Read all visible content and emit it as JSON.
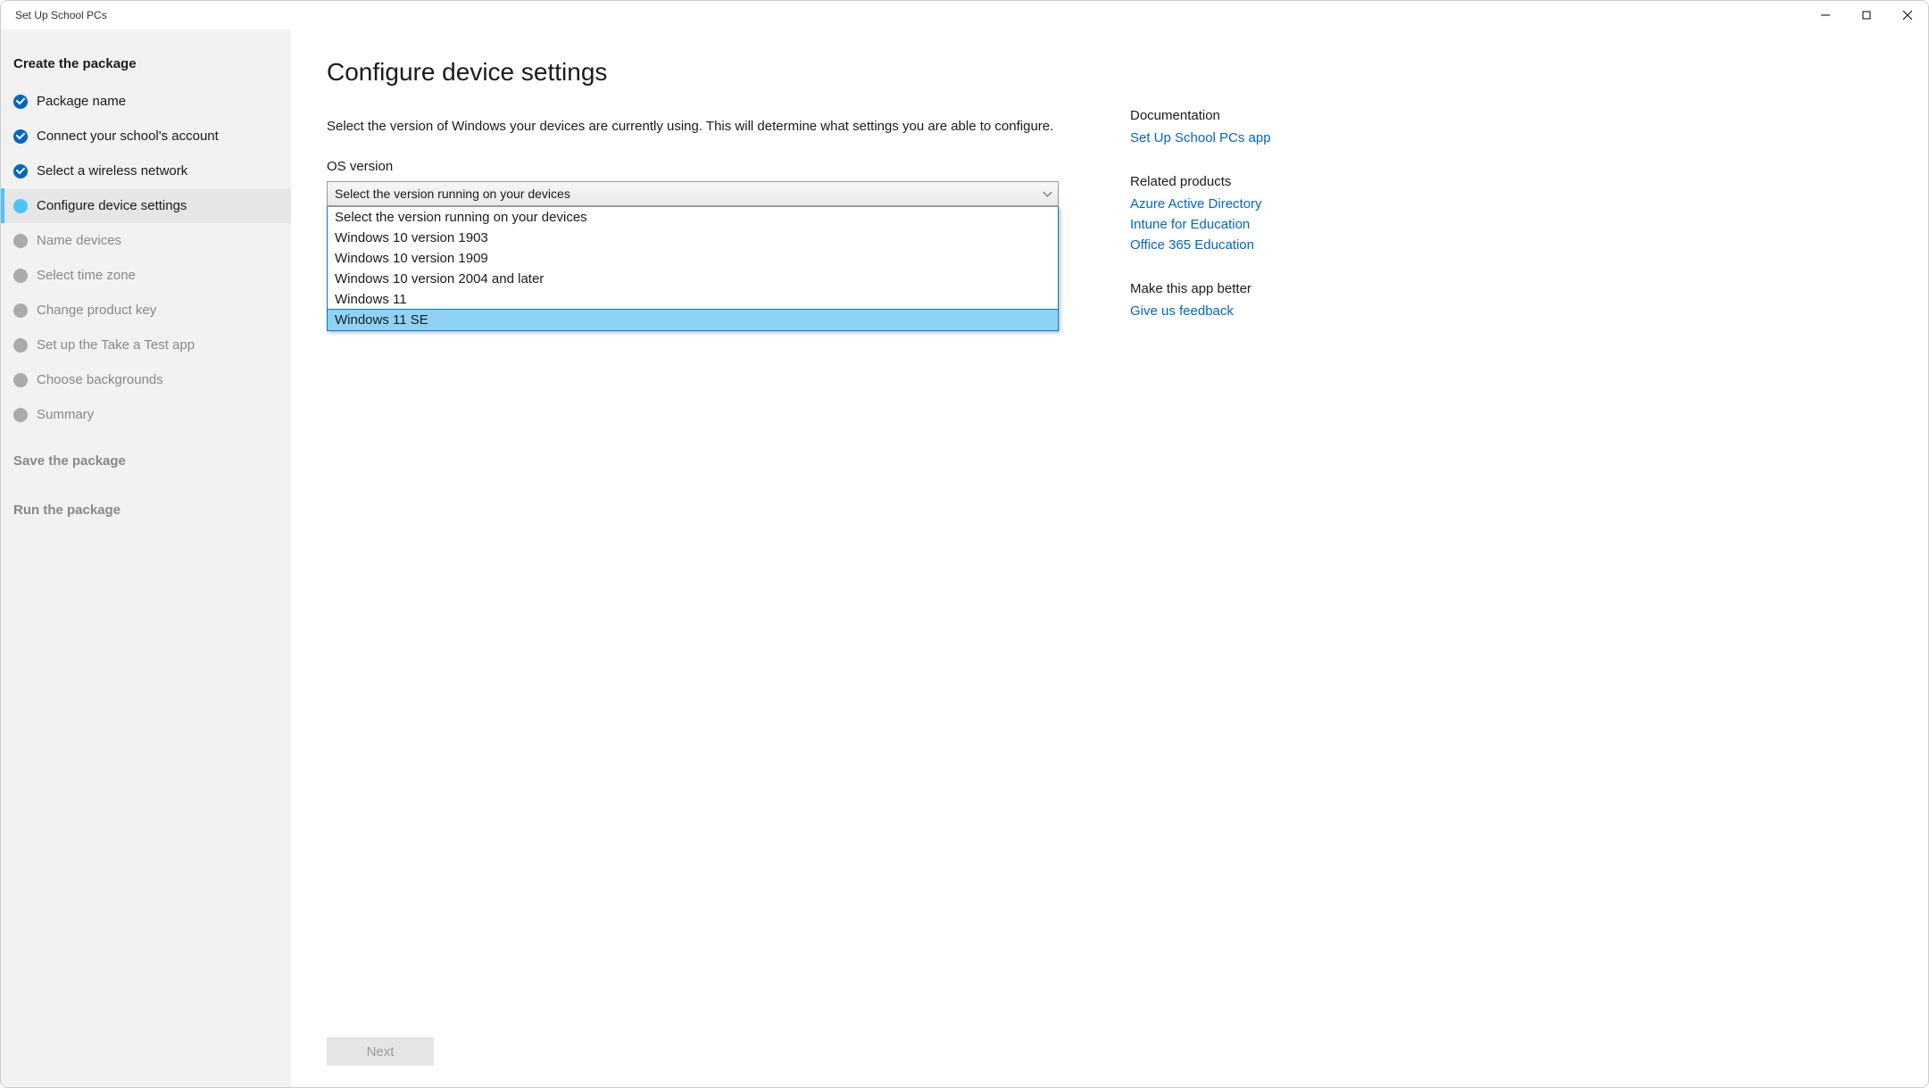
{
  "window": {
    "title": "Set Up School PCs"
  },
  "sidebar": {
    "sections": {
      "create": {
        "title": "Create the package"
      },
      "save": {
        "title": "Save the package"
      },
      "run": {
        "title": "Run the package"
      }
    },
    "steps": [
      {
        "label": "Package name",
        "state": "done"
      },
      {
        "label": "Connect your school's account",
        "state": "done"
      },
      {
        "label": "Select a wireless network",
        "state": "done"
      },
      {
        "label": "Configure device settings",
        "state": "current"
      },
      {
        "label": "Name devices",
        "state": "pending"
      },
      {
        "label": "Select time zone",
        "state": "pending"
      },
      {
        "label": "Change product key",
        "state": "pending"
      },
      {
        "label": "Set up the Take a Test app",
        "state": "pending"
      },
      {
        "label": "Choose backgrounds",
        "state": "pending"
      },
      {
        "label": "Summary",
        "state": "pending"
      }
    ]
  },
  "main": {
    "title": "Configure device settings",
    "description": "Select the version of Windows your devices are currently using. This will determine what settings you are able to configure.",
    "os_label": "OS version",
    "select_placeholder": "Select the version running on your devices",
    "options": [
      "Select the version running on your devices",
      "Windows 10 version 1903",
      "Windows 10 version 1909",
      "Windows 10 version 2004 and later",
      "Windows 11",
      "Windows 11 SE"
    ],
    "highlight_index": 5,
    "next_label": "Next"
  },
  "aside": {
    "doc_header": "Documentation",
    "doc_link": "Set Up School PCs app",
    "related_header": "Related products",
    "related_links": [
      "Azure Active Directory",
      "Intune for Education",
      "Office 365 Education"
    ],
    "better_header": "Make this app better",
    "feedback_link": "Give us feedback"
  }
}
